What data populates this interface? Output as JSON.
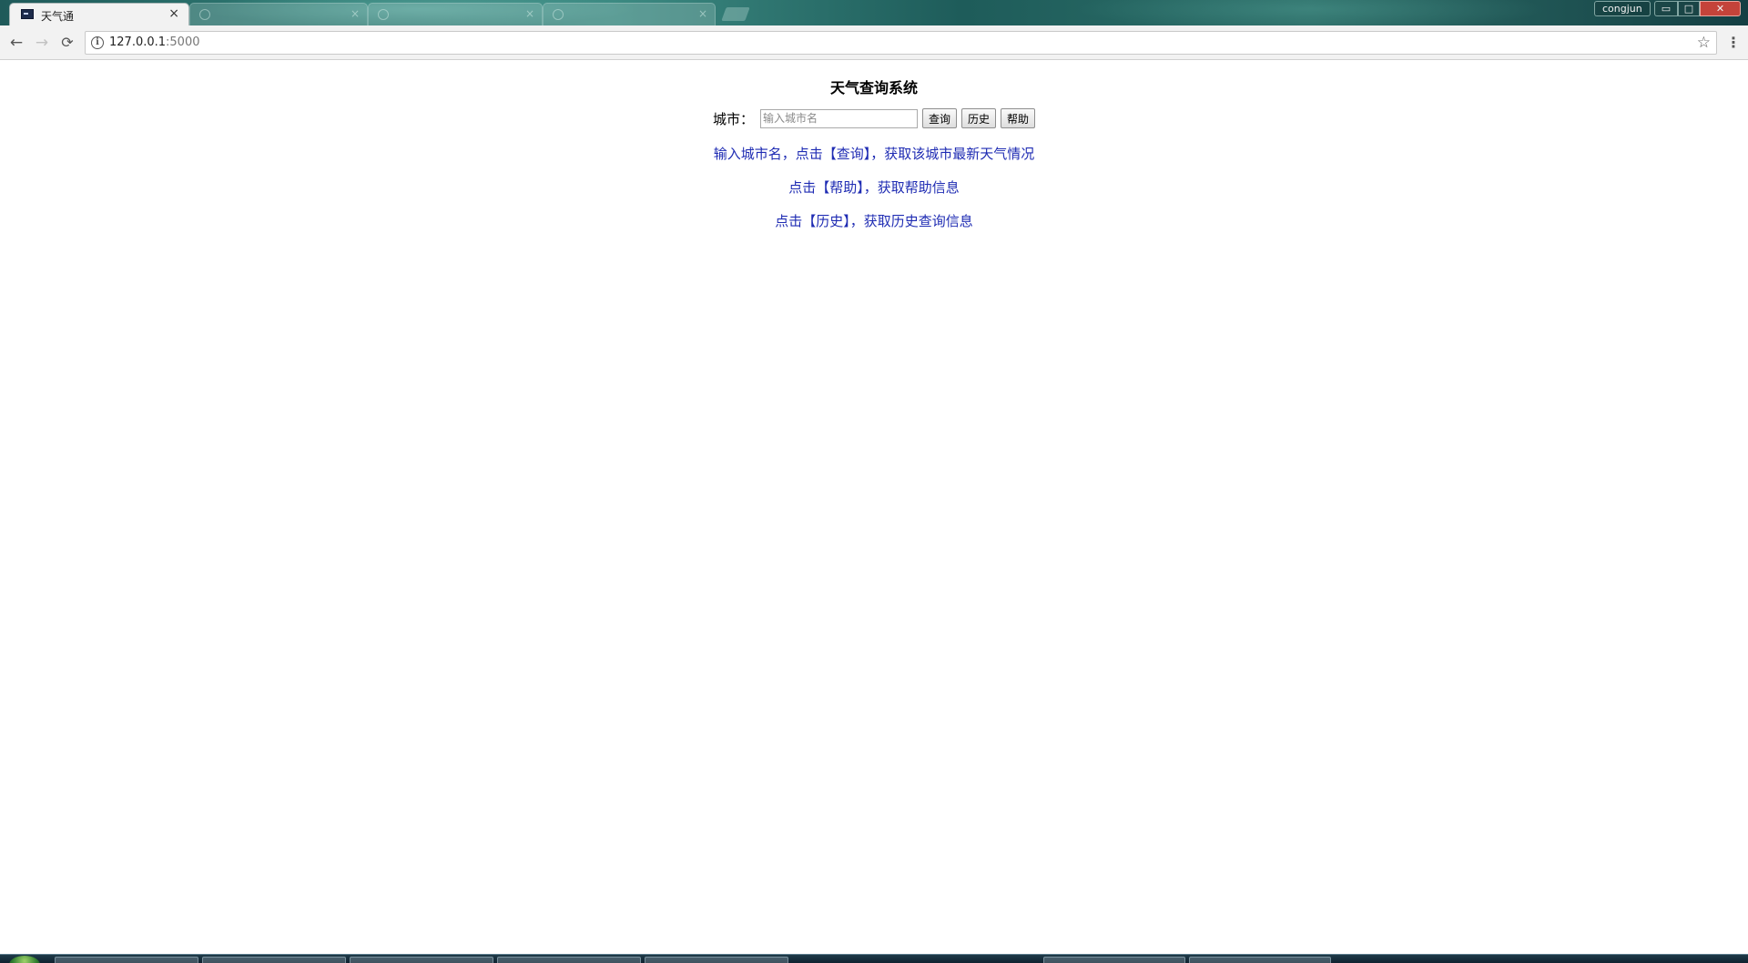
{
  "browser": {
    "active_tab": {
      "title": "天气通",
      "close_glyph": "×"
    },
    "inactive_tabs": [
      {
        "title": "",
        "close_glyph": "×"
      },
      {
        "title": "",
        "close_glyph": "×"
      },
      {
        "title": "",
        "close_glyph": "×"
      }
    ],
    "user_name": "congjun",
    "window_controls": {
      "minimize": "▭",
      "maximize": "□",
      "close": "✕"
    },
    "url": {
      "host": "127.0.0.1",
      "port": ":5000"
    },
    "nav_icons": {
      "back": "←",
      "forward": "→",
      "reload": "⟳",
      "info": "i",
      "star": "☆",
      "menu": "⋮"
    }
  },
  "page": {
    "title": "天气查询系统",
    "city_label": "城市：",
    "city_input": {
      "value": "",
      "placeholder": "输入城市名"
    },
    "buttons": {
      "query": "查询",
      "history": "历史",
      "help": "帮助"
    },
    "hints": [
      "输入城市名，点击【查询】，获取该城市最新天气情况",
      "点击【帮助】，获取帮助信息",
      "点击【历史】，获取历史查询信息"
    ]
  }
}
